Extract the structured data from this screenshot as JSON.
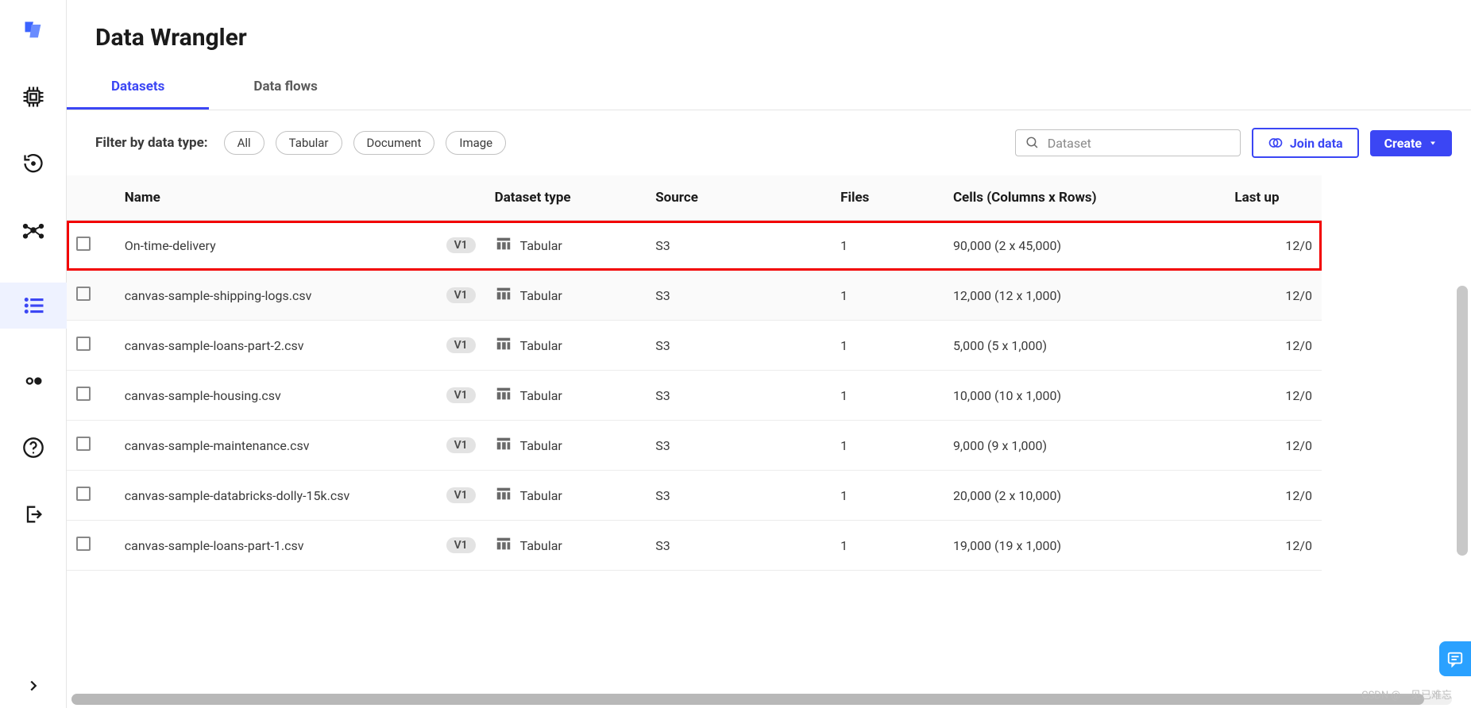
{
  "page": {
    "title": "Data Wrangler"
  },
  "tabs": {
    "datasets": "Datasets",
    "dataflows": "Data flows"
  },
  "filter": {
    "label": "Filter by data type:",
    "all": "All",
    "tabular": "Tabular",
    "document": "Document",
    "image": "Image"
  },
  "search": {
    "placeholder": "Dataset"
  },
  "buttons": {
    "join": "Join data",
    "create": "Create"
  },
  "columns": {
    "name": "Name",
    "type": "Dataset type",
    "source": "Source",
    "files": "Files",
    "cells": "Cells (Columns x Rows)",
    "last": "Last up"
  },
  "rows": [
    {
      "name": "On-time-delivery",
      "version": "V1",
      "type": "Tabular",
      "source": "S3",
      "files": "1",
      "cells": "90,000 (2 x 45,000)",
      "last": "12/0"
    },
    {
      "name": "canvas-sample-shipping-logs.csv",
      "version": "V1",
      "type": "Tabular",
      "source": "S3",
      "files": "1",
      "cells": "12,000 (12 x 1,000)",
      "last": "12/0"
    },
    {
      "name": "canvas-sample-loans-part-2.csv",
      "version": "V1",
      "type": "Tabular",
      "source": "S3",
      "files": "1",
      "cells": "5,000 (5 x 1,000)",
      "last": "12/0"
    },
    {
      "name": "canvas-sample-housing.csv",
      "version": "V1",
      "type": "Tabular",
      "source": "S3",
      "files": "1",
      "cells": "10,000 (10 x 1,000)",
      "last": "12/0"
    },
    {
      "name": "canvas-sample-maintenance.csv",
      "version": "V1",
      "type": "Tabular",
      "source": "S3",
      "files": "1",
      "cells": "9,000 (9 x 1,000)",
      "last": "12/0"
    },
    {
      "name": "canvas-sample-databricks-dolly-15k.csv",
      "version": "V1",
      "type": "Tabular",
      "source": "S3",
      "files": "1",
      "cells": "20,000 (2 x 10,000)",
      "last": "12/0"
    },
    {
      "name": "canvas-sample-loans-part-1.csv",
      "version": "V1",
      "type": "Tabular",
      "source": "S3",
      "files": "1",
      "cells": "19,000 (19 x 1,000)",
      "last": "12/0"
    }
  ],
  "watermark": "CSDN @一见已难忘"
}
